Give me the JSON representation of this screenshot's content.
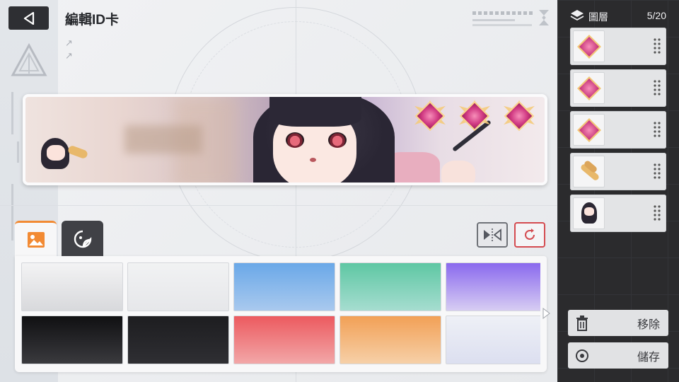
{
  "header": {
    "title": "編輯ID卡"
  },
  "layers": {
    "title": "圖層",
    "count": "5/20",
    "items": [
      {
        "icon": "badge-icon"
      },
      {
        "icon": "badge-icon"
      },
      {
        "icon": "badge-icon"
      },
      {
        "icon": "food-skewer-icon"
      },
      {
        "icon": "chibi-character-icon"
      }
    ]
  },
  "actions": {
    "remove_label": "移除",
    "save_label": "儲存"
  },
  "tabs": [
    {
      "name": "background",
      "icon": "image-icon",
      "selected": true
    },
    {
      "name": "sticker",
      "icon": "sticker-icon",
      "selected": false
    }
  ],
  "swatches": [
    {
      "name": "white-marble",
      "colors": [
        "#f3f3f4",
        "#d8d9dc"
      ]
    },
    {
      "name": "white-grid",
      "colors": [
        "#f1f2f3",
        "#e6e7ea"
      ]
    },
    {
      "name": "blue",
      "colors": [
        "#6aa8e8",
        "#a9c9ee"
      ]
    },
    {
      "name": "green",
      "colors": [
        "#5ec7a3",
        "#a6ddd0"
      ]
    },
    {
      "name": "purple",
      "colors": [
        "#8a69ee",
        "#d7cdf3"
      ]
    },
    {
      "name": "black-marble",
      "colors": [
        "#101012",
        "#3a3a3e"
      ]
    },
    {
      "name": "black-grid",
      "colors": [
        "#1d1d20",
        "#2f2f33"
      ]
    },
    {
      "name": "red",
      "colors": [
        "#ec5a5f",
        "#f2a7a8"
      ]
    },
    {
      "name": "orange",
      "colors": [
        "#f2a056",
        "#f6d0a8"
      ]
    },
    {
      "name": "white-iridescent",
      "colors": [
        "#eef0f6",
        "#dcdff0"
      ]
    }
  ],
  "colors": {
    "accent_orange": "#f28a33",
    "reset_red": "#d44b50",
    "sidebar_bg": "#2b2b2d"
  }
}
